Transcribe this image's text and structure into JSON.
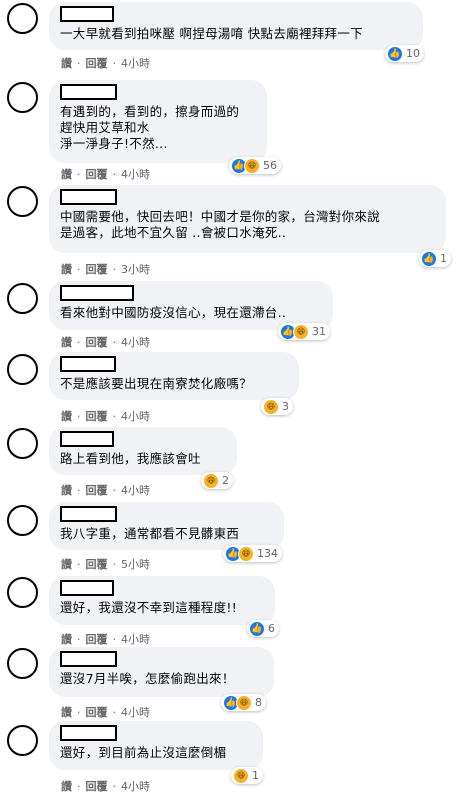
{
  "actions": {
    "like": "讚",
    "reply": "回覆",
    "dot": "·"
  },
  "comments": [
    {
      "text": "一大早就看到拍咪壓 啊捏母湯唷 快點去廟裡拜拜一下",
      "reaction_icons": [
        "like-icon"
      ],
      "count": "10",
      "time": "4小時"
    },
    {
      "text": "有遇到的，看到的，擦身而過的\n趕快用艾草和水\n淨一淨身子!不然...",
      "reaction_icons": [
        "like-icon",
        "haha-icon"
      ],
      "count": "56",
      "time": "4小時"
    },
    {
      "text": "中國需要他，快回去吧！中國才是你的家，台灣對你來說\n是過客，此地不宜久留 ..會被口水淹死..",
      "reaction_icons": [
        "like-icon"
      ],
      "count": "1",
      "time": "3小時"
    },
    {
      "text": "看來他對中國防疫沒信心，現在還滯台..",
      "reaction_icons": [
        "like-icon",
        "haha-icon"
      ],
      "count": "31",
      "time": "4小時"
    },
    {
      "text": "不是應該要出現在南寮焚化廠嗎？",
      "reaction_icons": [
        "haha-icon"
      ],
      "count": "3",
      "time": "4小時"
    },
    {
      "text": "路上看到他，我應該會吐",
      "reaction_icons": [
        "haha-icon"
      ],
      "count": "2",
      "time": "4小時"
    },
    {
      "text": "我八字重，通常都看不見髒東西",
      "reaction_icons": [
        "like-icon",
        "haha-icon"
      ],
      "count": "134",
      "time": "5小時"
    },
    {
      "text": "還好，我還沒不幸到這種程度!!",
      "reaction_icons": [
        "like-icon"
      ],
      "count": "6",
      "time": "4小時"
    },
    {
      "text": "還沒7月半唉，怎麼偷跑出來！",
      "reaction_icons": [
        "like-icon",
        "haha-icon"
      ],
      "count": "8",
      "time": "4小時"
    },
    {
      "text": "還好，到目前為止沒這麼倒楣",
      "reaction_icons": [
        "haha-icon"
      ],
      "count": "1",
      "time": "4小時"
    }
  ]
}
